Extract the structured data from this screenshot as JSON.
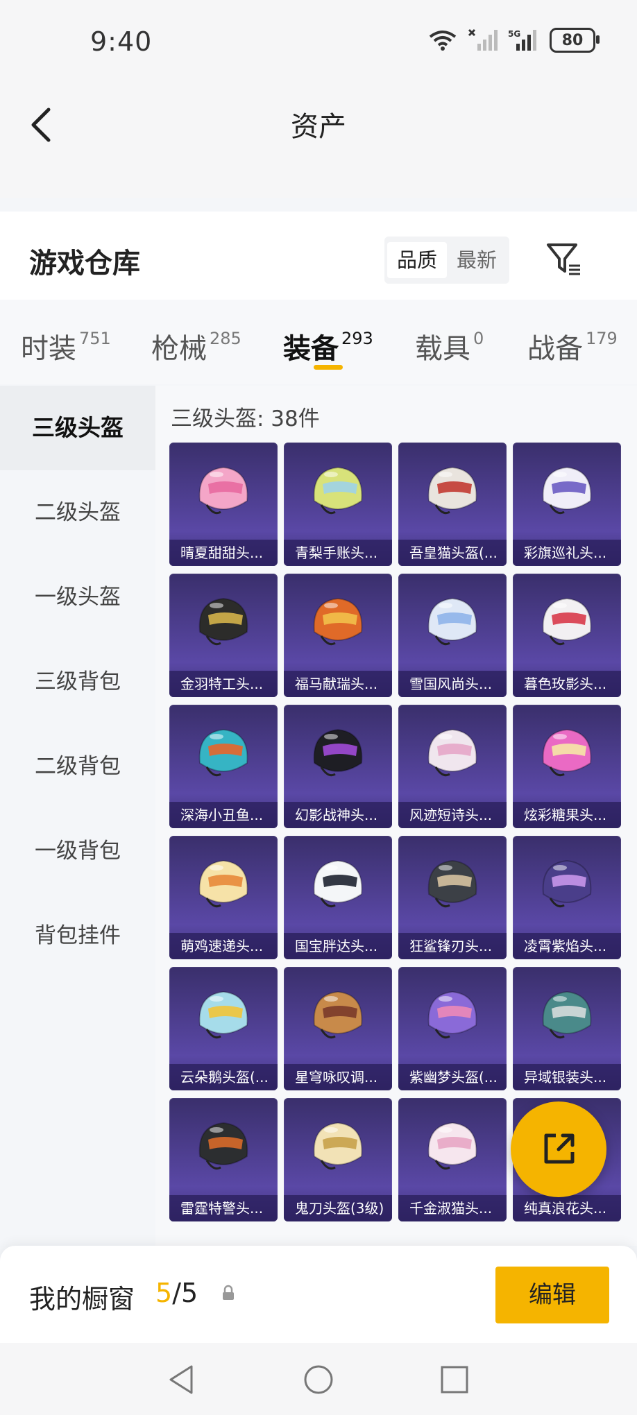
{
  "status_bar": {
    "time": "9:40",
    "battery": "80",
    "network": "5G"
  },
  "header": {
    "title": "资产"
  },
  "warehouse": {
    "title": "游戏仓库",
    "sort_options": [
      "品质",
      "最新"
    ],
    "sort_selected": "品质"
  },
  "tabs": [
    {
      "label": "时装",
      "count": "751"
    },
    {
      "label": "枪械",
      "count": "285"
    },
    {
      "label": "装备",
      "count": "293",
      "active": true
    },
    {
      "label": "载具",
      "count": "0"
    },
    {
      "label": "战备",
      "count": "179"
    }
  ],
  "sidebar": {
    "items": [
      "三级头盔",
      "二级头盔",
      "一级头盔",
      "三级背包",
      "二级背包",
      "一级背包",
      "背包挂件"
    ],
    "active_index": 0
  },
  "content": {
    "count_label": "三级头盔: 38件",
    "items": [
      {
        "name": "晴夏甜甜头...",
        "color": "#f4a6c8",
        "accent": "#e86aa0"
      },
      {
        "name": "青梨手账头...",
        "color": "#d8e27a",
        "accent": "#9fd3e8"
      },
      {
        "name": "吾皇猫头盔(...",
        "color": "#e9e4de",
        "accent": "#c23a32"
      },
      {
        "name": "彩旗巡礼头...",
        "color": "#f0eef8",
        "accent": "#6a5bc2"
      },
      {
        "name": "金羽特工头...",
        "color": "#2c2c2a",
        "accent": "#d4b24a"
      },
      {
        "name": "福马献瑞头...",
        "color": "#e06a28",
        "accent": "#f2c14a"
      },
      {
        "name": "雪国风尚头...",
        "color": "#dfe8f6",
        "accent": "#8fb4ea"
      },
      {
        "name": "暮色玫影头...",
        "color": "#f2f0f2",
        "accent": "#d83a4a"
      },
      {
        "name": "深海小丑鱼...",
        "color": "#36b4c4",
        "accent": "#e8652a"
      },
      {
        "name": "幻影战神头...",
        "color": "#1e1e24",
        "accent": "#a04ad8"
      },
      {
        "name": "风迹短诗头...",
        "color": "#f0e6ee",
        "accent": "#e6a6c8"
      },
      {
        "name": "炫彩糖果头...",
        "color": "#ea6ac4",
        "accent": "#f6e8a6"
      },
      {
        "name": "萌鸡速递头...",
        "color": "#f6e2a8",
        "accent": "#e88a3a"
      },
      {
        "name": "国宝胖达头...",
        "color": "#f4f6f8",
        "accent": "#1e2430"
      },
      {
        "name": "狂鲨锋刃头...",
        "color": "#3c4046",
        "accent": "#d6c2a0"
      },
      {
        "name": "凌霄紫焰头...",
        "color": "#4a3e8a",
        "accent": "#c896ea"
      },
      {
        "name": "云朵鹅头盔(...",
        "color": "#a6dcea",
        "accent": "#f2c43a"
      },
      {
        "name": "星穹咏叹调...",
        "color": "#c88a4a",
        "accent": "#7a3a2a"
      },
      {
        "name": "紫幽梦头盔(...",
        "color": "#8a6ad8",
        "accent": "#ec8ab8"
      },
      {
        "name": "异域银装头...",
        "color": "#4a8a8a",
        "accent": "#d6dcdc"
      },
      {
        "name": "雷霆特警头...",
        "color": "#2c2e30",
        "accent": "#d86a2a"
      },
      {
        "name": "鬼刀头盔(3级)",
        "color": "#f2e2b6",
        "accent": "#c8a24a"
      },
      {
        "name": "千金淑猫头...",
        "color": "#f6e6ee",
        "accent": "#e8a6c4"
      },
      {
        "name": "纯真浪花头...",
        "color": "#f2a6c8",
        "accent": "#ffffff"
      }
    ]
  },
  "bottom": {
    "label": "我的橱窗",
    "current": "5",
    "total": "/5",
    "edit_label": "编辑"
  },
  "colors": {
    "accent": "#f5b400",
    "card_bg": "#4a3c8e"
  }
}
